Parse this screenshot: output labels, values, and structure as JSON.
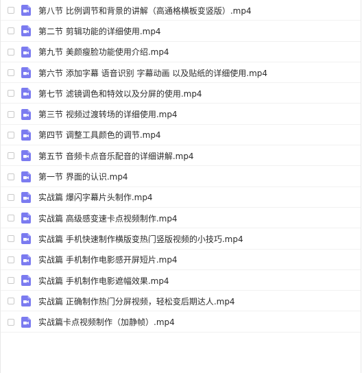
{
  "colors": {
    "icon_purple": "#7b7bf0",
    "icon_play": "#ffffff",
    "text": "#2b2b2b",
    "checkbox_border": "#c9c9c9"
  },
  "file_icon": "video-file-icon",
  "files": [
    {
      "name": "第八节 比例调节和背景的讲解（高通格横板变竖版）.mp4"
    },
    {
      "name": "第二节 剪辑功能的详细使用.mp4"
    },
    {
      "name": "第九节 美颜瘦脸功能使用介绍.mp4"
    },
    {
      "name": "第六节 添加字幕 语音识别 字幕动画 以及贴纸的详细使用.mp4"
    },
    {
      "name": "第七节 滤镜调色和特效以及分屏的使用.mp4"
    },
    {
      "name": "第三节 视频过渡转场的详细使用.mp4"
    },
    {
      "name": "第四节 调整工具颜色的调节.mp4"
    },
    {
      "name": "第五节 音频卡点音乐配音的详细讲解.mp4"
    },
    {
      "name": "第一节 界面的认识.mp4"
    },
    {
      "name": "实战篇 爆闪字幕片头制作.mp4"
    },
    {
      "name": "实战篇 高级感变速卡点视频制作.mp4"
    },
    {
      "name": "实战篇 手机快速制作横版变热门竖版视频的小技巧.mp4"
    },
    {
      "name": "实战篇 手机制作电影感开屏短片.mp4"
    },
    {
      "name": "实战篇 手机制作电影遮幅效果.mp4"
    },
    {
      "name": "实战篇 正确制作热门分屏视频，轻松变后期达人.mp4"
    },
    {
      "name": "实战篇卡点视频制作（加静帧）.mp4"
    }
  ]
}
